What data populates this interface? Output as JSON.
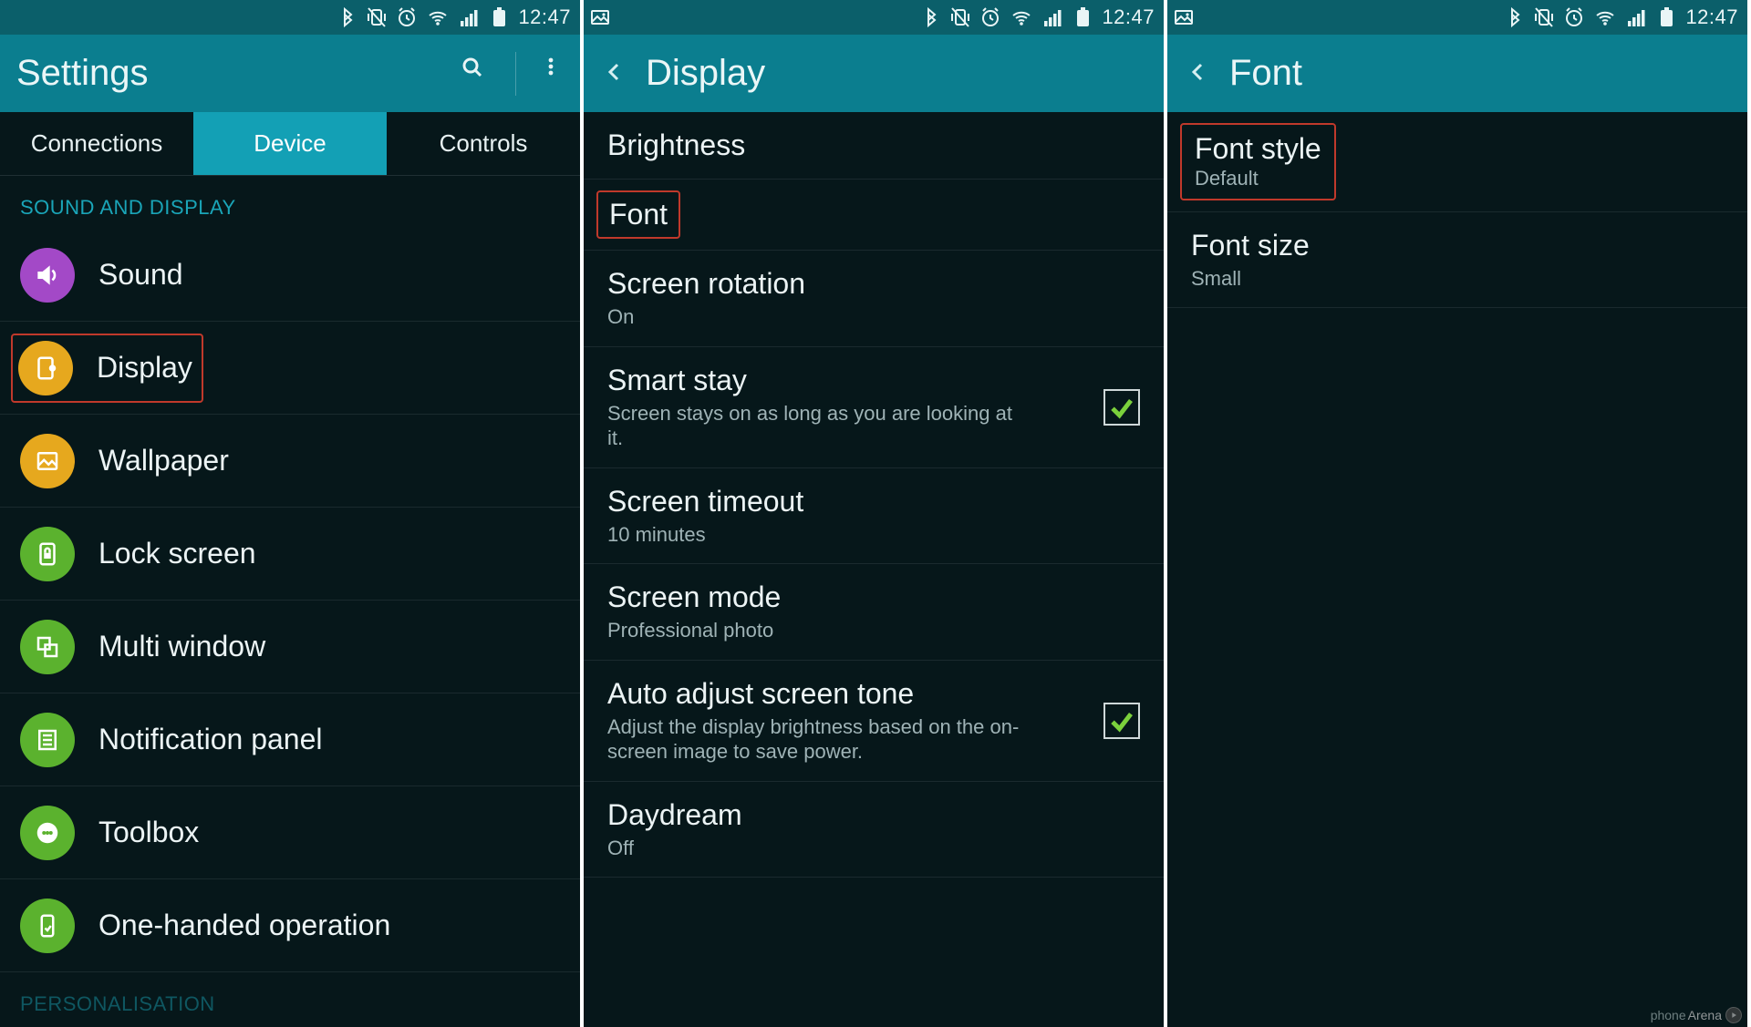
{
  "status": {
    "time": "12:47"
  },
  "watermark": {
    "a": "phone",
    "b": "Arena"
  },
  "screen1": {
    "title": "Settings",
    "tabs": [
      "Connections",
      "Device",
      "Controls"
    ],
    "active_tab": 1,
    "section": "SOUND AND DISPLAY",
    "items": [
      {
        "label": "Sound",
        "color": "#a349c7",
        "icon": "volume"
      },
      {
        "label": "Display",
        "color": "#e6a81e",
        "icon": "display",
        "highlight": true
      },
      {
        "label": "Wallpaper",
        "color": "#e6a81e",
        "icon": "image"
      },
      {
        "label": "Lock screen",
        "color": "#5bb22e",
        "icon": "lock"
      },
      {
        "label": "Multi window",
        "color": "#5bb22e",
        "icon": "multiwindow"
      },
      {
        "label": "Notification panel",
        "color": "#5bb22e",
        "icon": "panel"
      },
      {
        "label": "Toolbox",
        "color": "#5bb22e",
        "icon": "dots"
      },
      {
        "label": "One-handed operation",
        "color": "#5bb22e",
        "icon": "onehand"
      }
    ],
    "section2": "PERSONALISATION"
  },
  "screen2": {
    "title": "Display",
    "items": [
      {
        "t": "Brightness"
      },
      {
        "t": "Font",
        "highlight": true
      },
      {
        "t": "Screen rotation",
        "s": "On"
      },
      {
        "t": "Smart stay",
        "s": "Screen stays on as long as you are looking at it.",
        "checked": true
      },
      {
        "t": "Screen timeout",
        "s": "10 minutes"
      },
      {
        "t": "Screen mode",
        "s": "Professional photo"
      },
      {
        "t": "Auto adjust screen tone",
        "s": "Adjust the display brightness based on the on-screen image to save power.",
        "checked": true
      },
      {
        "t": "Daydream",
        "s": "Off"
      }
    ]
  },
  "screen3": {
    "title": "Font",
    "items": [
      {
        "t": "Font style",
        "s": "Default",
        "highlight": true
      },
      {
        "t": "Font size",
        "s": "Small"
      }
    ]
  }
}
